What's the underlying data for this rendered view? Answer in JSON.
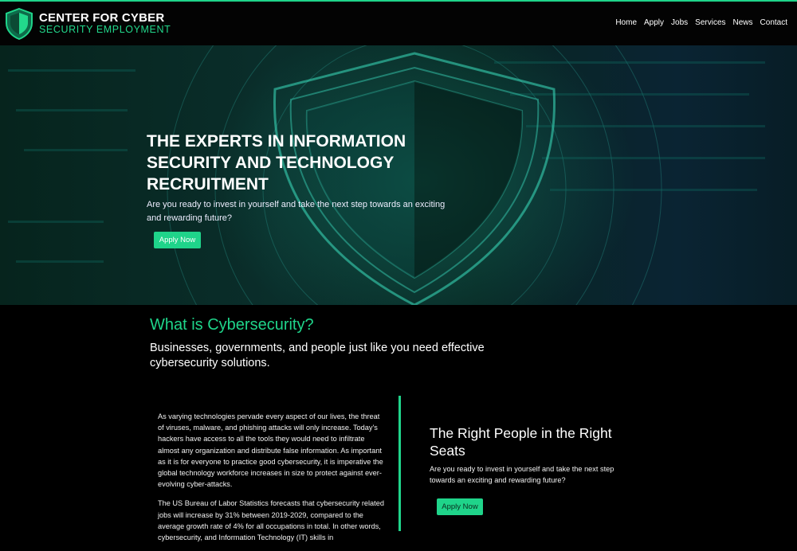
{
  "brand": {
    "line1": "CENTER FOR CYBER",
    "line2": "SECURITY EMPLOYMENT",
    "accent_color": "#1fd48a"
  },
  "nav": {
    "items": [
      {
        "label": "Home"
      },
      {
        "label": "Apply"
      },
      {
        "label": "Jobs"
      },
      {
        "label": "Services"
      },
      {
        "label": "News"
      },
      {
        "label": "Contact"
      }
    ]
  },
  "hero": {
    "title": "THE EXPERTS IN INFORMATION SECURITY AND TECHNOLOGY RECRUITMENT",
    "subtitle": "Are you ready to invest in yourself and take the next step towards an exciting and rewarding future?",
    "button_label": "Apply Now",
    "background_icon": "shield-icon"
  },
  "what_is": {
    "heading": "What is Cybersecurity?",
    "subheading": "Businesses, governments, and people just like you need effective cybersecurity solutions."
  },
  "body_left": {
    "paragraph1": "As varying technologies pervade every aspect of our lives, the threat of viruses, malware, and phishing attacks will only increase. Today's hackers have access to all the tools they would need to infiltrate almost any organization and distribute false information. As important as it is for everyone to practice good cybersecurity, it is imperative the global technology workforce increases in size to protect against ever-evolving cyber-attacks.",
    "paragraph2": "The US Bureau of Labor Statistics forecasts that cybersecurity related jobs will increase by 31% between 2019-2029, compared to the average growth rate of 4% for all occupations in total. In other words, cybersecurity, and Information Technology (IT) skills in"
  },
  "body_right": {
    "heading": "The Right People in the Right Seats",
    "text": "Are you ready to invest in yourself and take the next step towards an exciting and rewarding future?",
    "button_label": "Apply Now"
  }
}
